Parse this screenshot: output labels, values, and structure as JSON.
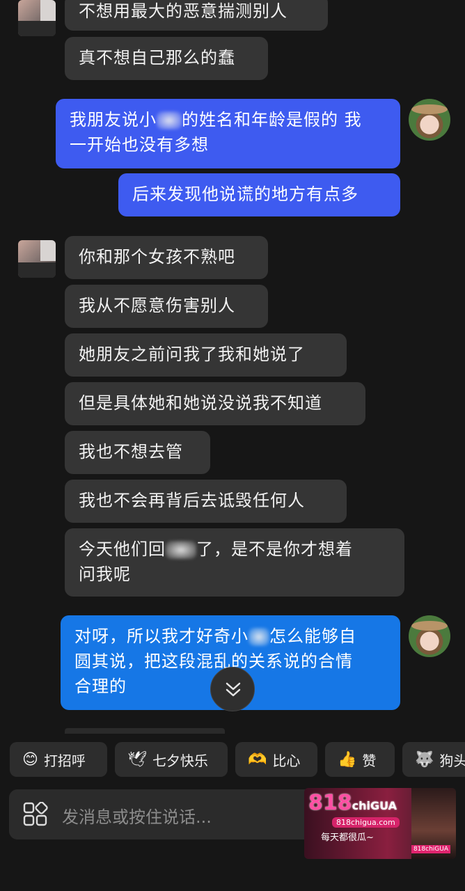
{
  "messages": [
    {
      "side": "left",
      "text": "不想用最大的恶意揣测别人"
    },
    {
      "side": "left",
      "text": "真不想自己那么的蠢"
    },
    {
      "side": "right",
      "parts": [
        "我朋友说小",
        "的姓名和年龄是假的 我",
        "一开始也没有多想"
      ]
    },
    {
      "side": "right",
      "text": "后来发现他说谎的地方有点多"
    },
    {
      "side": "left",
      "text": "你和那个女孩不熟吧"
    },
    {
      "side": "left",
      "text": "我从不愿意伤害别人"
    },
    {
      "side": "left",
      "text": "她朋友之前问我了我和她说了"
    },
    {
      "side": "left",
      "text": "但是具体她和她说没说我不知道"
    },
    {
      "side": "left",
      "text": "我也不想去管"
    },
    {
      "side": "left",
      "text": "我也不会再背后去诋毁任何人"
    },
    {
      "side": "left",
      "parts": [
        "今天他们回",
        "了，是不是你才想着",
        "问我呢"
      ]
    },
    {
      "side": "right",
      "parts": [
        "对呀，所以我才好奇小",
        "怎么能够自",
        "圆其说，把这段混乱的关系说的合情",
        "合理的"
      ]
    }
  ],
  "quick_replies": [
    {
      "icon": "😊",
      "label": "打招呼"
    },
    {
      "icon": "🕊",
      "label": "七夕快乐"
    },
    {
      "icon": "🫶",
      "label": "比心"
    },
    {
      "icon": "👍",
      "label": "赞"
    },
    {
      "icon": "🐺",
      "label": "狗头"
    }
  ],
  "input": {
    "placeholder": "发消息或按住说话..."
  },
  "watermark": {
    "logo": "818",
    "logo_suffix": "chiGUA",
    "site": "818chigua.com",
    "slogan": "每天都很瓜~",
    "tag": "818chiGUA"
  },
  "colors": {
    "bg": "#161616",
    "left_bubble": "#353535",
    "right_bubble_indigo": "#3e5bf0",
    "right_bubble_blue": "#1677e6"
  }
}
